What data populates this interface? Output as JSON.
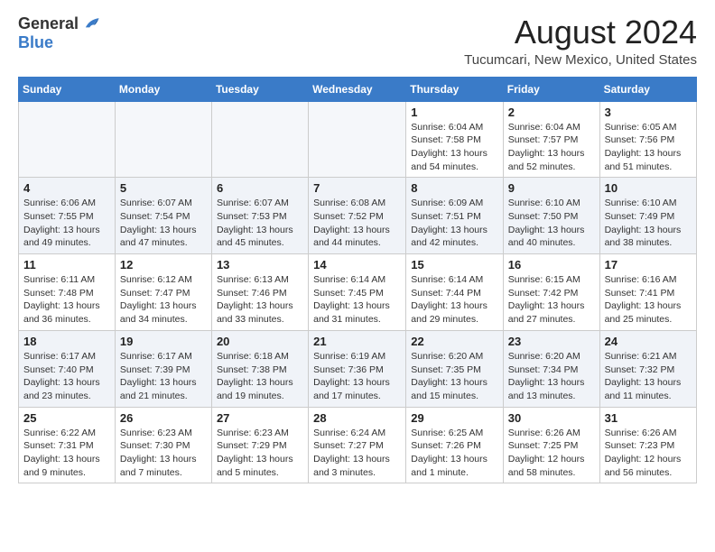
{
  "header": {
    "logo_general": "General",
    "logo_blue": "Blue",
    "title": "August 2024",
    "subtitle": "Tucumcari, New Mexico, United States"
  },
  "calendar": {
    "days_of_week": [
      "Sunday",
      "Monday",
      "Tuesday",
      "Wednesday",
      "Thursday",
      "Friday",
      "Saturday"
    ],
    "weeks": [
      [
        {
          "day": "",
          "detail": ""
        },
        {
          "day": "",
          "detail": ""
        },
        {
          "day": "",
          "detail": ""
        },
        {
          "day": "",
          "detail": ""
        },
        {
          "day": "1",
          "detail": "Sunrise: 6:04 AM\nSunset: 7:58 PM\nDaylight: 13 hours\nand 54 minutes."
        },
        {
          "day": "2",
          "detail": "Sunrise: 6:04 AM\nSunset: 7:57 PM\nDaylight: 13 hours\nand 52 minutes."
        },
        {
          "day": "3",
          "detail": "Sunrise: 6:05 AM\nSunset: 7:56 PM\nDaylight: 13 hours\nand 51 minutes."
        }
      ],
      [
        {
          "day": "4",
          "detail": "Sunrise: 6:06 AM\nSunset: 7:55 PM\nDaylight: 13 hours\nand 49 minutes."
        },
        {
          "day": "5",
          "detail": "Sunrise: 6:07 AM\nSunset: 7:54 PM\nDaylight: 13 hours\nand 47 minutes."
        },
        {
          "day": "6",
          "detail": "Sunrise: 6:07 AM\nSunset: 7:53 PM\nDaylight: 13 hours\nand 45 minutes."
        },
        {
          "day": "7",
          "detail": "Sunrise: 6:08 AM\nSunset: 7:52 PM\nDaylight: 13 hours\nand 44 minutes."
        },
        {
          "day": "8",
          "detail": "Sunrise: 6:09 AM\nSunset: 7:51 PM\nDaylight: 13 hours\nand 42 minutes."
        },
        {
          "day": "9",
          "detail": "Sunrise: 6:10 AM\nSunset: 7:50 PM\nDaylight: 13 hours\nand 40 minutes."
        },
        {
          "day": "10",
          "detail": "Sunrise: 6:10 AM\nSunset: 7:49 PM\nDaylight: 13 hours\nand 38 minutes."
        }
      ],
      [
        {
          "day": "11",
          "detail": "Sunrise: 6:11 AM\nSunset: 7:48 PM\nDaylight: 13 hours\nand 36 minutes."
        },
        {
          "day": "12",
          "detail": "Sunrise: 6:12 AM\nSunset: 7:47 PM\nDaylight: 13 hours\nand 34 minutes."
        },
        {
          "day": "13",
          "detail": "Sunrise: 6:13 AM\nSunset: 7:46 PM\nDaylight: 13 hours\nand 33 minutes."
        },
        {
          "day": "14",
          "detail": "Sunrise: 6:14 AM\nSunset: 7:45 PM\nDaylight: 13 hours\nand 31 minutes."
        },
        {
          "day": "15",
          "detail": "Sunrise: 6:14 AM\nSunset: 7:44 PM\nDaylight: 13 hours\nand 29 minutes."
        },
        {
          "day": "16",
          "detail": "Sunrise: 6:15 AM\nSunset: 7:42 PM\nDaylight: 13 hours\nand 27 minutes."
        },
        {
          "day": "17",
          "detail": "Sunrise: 6:16 AM\nSunset: 7:41 PM\nDaylight: 13 hours\nand 25 minutes."
        }
      ],
      [
        {
          "day": "18",
          "detail": "Sunrise: 6:17 AM\nSunset: 7:40 PM\nDaylight: 13 hours\nand 23 minutes."
        },
        {
          "day": "19",
          "detail": "Sunrise: 6:17 AM\nSunset: 7:39 PM\nDaylight: 13 hours\nand 21 minutes."
        },
        {
          "day": "20",
          "detail": "Sunrise: 6:18 AM\nSunset: 7:38 PM\nDaylight: 13 hours\nand 19 minutes."
        },
        {
          "day": "21",
          "detail": "Sunrise: 6:19 AM\nSunset: 7:36 PM\nDaylight: 13 hours\nand 17 minutes."
        },
        {
          "day": "22",
          "detail": "Sunrise: 6:20 AM\nSunset: 7:35 PM\nDaylight: 13 hours\nand 15 minutes."
        },
        {
          "day": "23",
          "detail": "Sunrise: 6:20 AM\nSunset: 7:34 PM\nDaylight: 13 hours\nand 13 minutes."
        },
        {
          "day": "24",
          "detail": "Sunrise: 6:21 AM\nSunset: 7:32 PM\nDaylight: 13 hours\nand 11 minutes."
        }
      ],
      [
        {
          "day": "25",
          "detail": "Sunrise: 6:22 AM\nSunset: 7:31 PM\nDaylight: 13 hours\nand 9 minutes."
        },
        {
          "day": "26",
          "detail": "Sunrise: 6:23 AM\nSunset: 7:30 PM\nDaylight: 13 hours\nand 7 minutes."
        },
        {
          "day": "27",
          "detail": "Sunrise: 6:23 AM\nSunset: 7:29 PM\nDaylight: 13 hours\nand 5 minutes."
        },
        {
          "day": "28",
          "detail": "Sunrise: 6:24 AM\nSunset: 7:27 PM\nDaylight: 13 hours\nand 3 minutes."
        },
        {
          "day": "29",
          "detail": "Sunrise: 6:25 AM\nSunset: 7:26 PM\nDaylight: 13 hours\nand 1 minute."
        },
        {
          "day": "30",
          "detail": "Sunrise: 6:26 AM\nSunset: 7:25 PM\nDaylight: 12 hours\nand 58 minutes."
        },
        {
          "day": "31",
          "detail": "Sunrise: 6:26 AM\nSunset: 7:23 PM\nDaylight: 12 hours\nand 56 minutes."
        }
      ]
    ]
  }
}
